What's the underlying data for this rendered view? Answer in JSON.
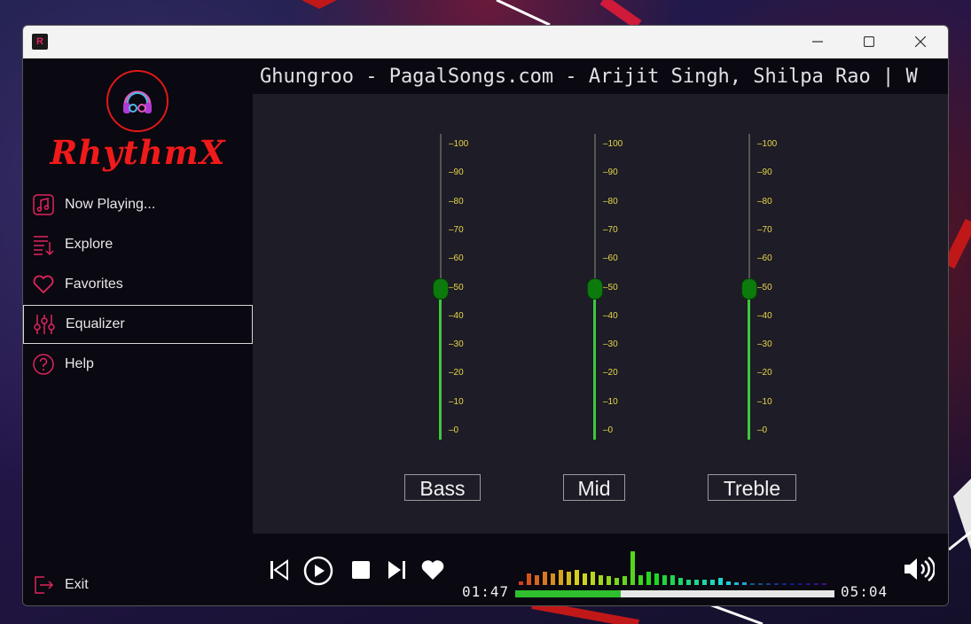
{
  "window": {
    "app_icon_glyph": "R",
    "controls": [
      "minimize-icon",
      "maximize-icon",
      "close-icon"
    ]
  },
  "sidebar": {
    "logo_text": "RhythmX",
    "items": [
      {
        "label": "Now Playing...",
        "icon": "music-note-icon"
      },
      {
        "label": "Explore",
        "icon": "playlist-icon"
      },
      {
        "label": "Favorites",
        "icon": "heart-icon"
      },
      {
        "label": "Equalizer",
        "icon": "equalizer-icon",
        "active": true
      },
      {
        "label": "Help",
        "icon": "help-icon"
      }
    ],
    "exit_label": "Exit"
  },
  "now_playing": {
    "marquee": "Ghungroo - PagalSongs.com - Arijit Singh, Shilpa Rao | W"
  },
  "equalizer": {
    "ticks": [
      "100",
      "90",
      "80",
      "70",
      "60",
      "50",
      "40",
      "30",
      "20",
      "10",
      "0"
    ],
    "bands": [
      {
        "label": "Bass",
        "value": 50
      },
      {
        "label": "Mid",
        "value": 50
      },
      {
        "label": "Treble",
        "value": 50
      }
    ]
  },
  "player": {
    "elapsed": "01:47",
    "total": "05:04",
    "progress": 0.33,
    "visualizer_levels": [
      0.1,
      0.35,
      0.3,
      0.4,
      0.35,
      0.45,
      0.4,
      0.45,
      0.35,
      0.4,
      0.3,
      0.25,
      0.2,
      0.25,
      1.0,
      0.3,
      0.4,
      0.35,
      0.3,
      0.3,
      0.2,
      0.15,
      0.15,
      0.15,
      0.15,
      0.2,
      0.1,
      0.08,
      0.08,
      0.06,
      0.06,
      0.05,
      0.05,
      0.04,
      0.04,
      0.04,
      0.03,
      0.03,
      0.03
    ],
    "colors": {
      "accent": "#2fbf2f",
      "brand": "#e01818"
    }
  }
}
